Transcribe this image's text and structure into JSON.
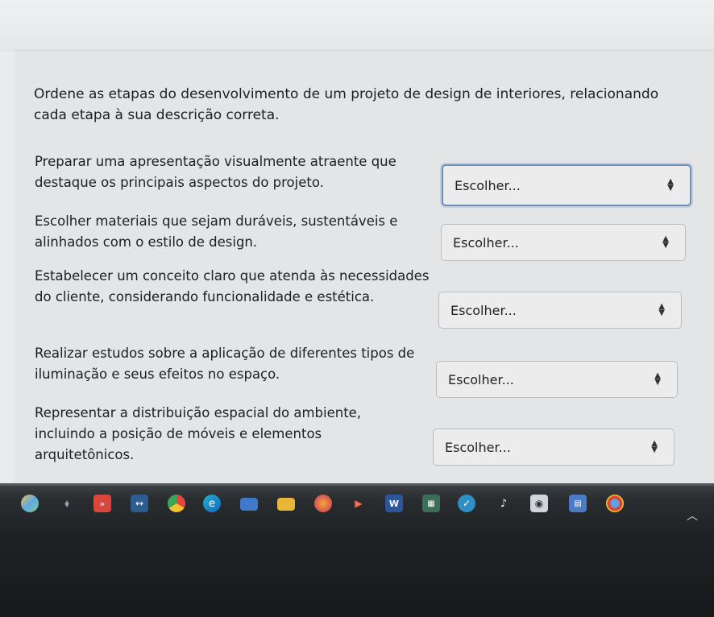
{
  "question": {
    "text": "Ordene as etapas do desenvolvimento de um projeto de design de interiores, relacionando cada etapa à sua descrição correta."
  },
  "matches": [
    {
      "description": "Preparar uma apresentação visualmente atraente que destaque os principais aspectos do projeto.",
      "selected": "Escolher..."
    },
    {
      "description": "Escolher materiais que sejam duráveis, sustentáveis e alinhados com o estilo de design.",
      "selected": "Escolher..."
    },
    {
      "description": "Estabelecer um conceito claro que atenda às necessidades do cliente, considerando funcionalidade e estética.",
      "selected": "Escolher..."
    },
    {
      "description": "Realizar estudos sobre a aplicação de diferentes tipos de iluminação e seus efeitos no espaço.",
      "selected": "Escolher..."
    },
    {
      "description": "Representar a distribuição espacial do ambiente, incluindo a posição de móveis e elementos arquitetônicos.",
      "selected": "Escolher..."
    }
  ],
  "colors": {
    "accent_focus": "#6e8fb8",
    "taskbar": "#1f2224"
  },
  "taskbar": {
    "icons": [
      "copilot-icon",
      "pin-icon",
      "media-icon",
      "lens-icon",
      "chrome-icon",
      "edge-icon",
      "folder-icon",
      "file-explorer-icon",
      "firefox-icon",
      "video-icon",
      "word-icon",
      "calendar-icon",
      "settings-icon",
      "music-icon",
      "camera-icon",
      "calculator-icon",
      "chrome-profile-icon",
      "tray-chevron-icon"
    ]
  }
}
